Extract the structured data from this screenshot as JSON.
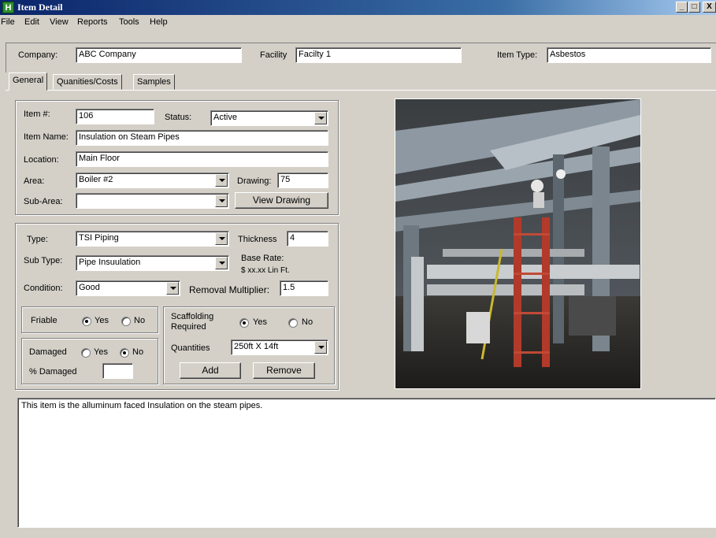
{
  "window": {
    "title": "Item Detail",
    "app_icon_letter": "H",
    "min": "_",
    "max": "□",
    "close": "X"
  },
  "menu": [
    "File",
    "Edit",
    "View",
    "Reports",
    "Tools",
    "Help"
  ],
  "header": {
    "company_label": "Company:",
    "company_value": "ABC Company",
    "facility_label": "Facility",
    "facility_value": "Facilty 1",
    "item_type_label": "Item Type:",
    "item_type_value": "Asbestos"
  },
  "tabs": [
    "General",
    "Quanities/Costs",
    "Samples"
  ],
  "general": {
    "item_no_label": "Item #:",
    "item_no": "106",
    "status_label": "Status:",
    "status": "Active",
    "item_name_label": "Item Name:",
    "item_name": "Insulation on Steam Pipes",
    "location_label": "Location:",
    "location": "Main Floor",
    "area_label": "Area:",
    "area": "Boiler #2",
    "drawing_label": "Drawing:",
    "drawing": "75",
    "subarea_label": "Sub-Area:",
    "subarea": "",
    "view_drawing": "View Drawing"
  },
  "material": {
    "type_label": "Type:",
    "type": "TSI Piping",
    "thickness_label": "Thickness",
    "thickness": "4",
    "subtype_label": "Sub Type:",
    "subtype": "Pipe Insuulation",
    "base_rate_label": "Base Rate:",
    "base_rate_value": "$ xx.xx Lin Ft.",
    "condition_label": "Condition:",
    "condition": "Good",
    "removal_label": "Removal Multiplier:",
    "removal": "1.5"
  },
  "friable": {
    "label": "Friable",
    "yes": "Yes",
    "no": "No",
    "selected": "Yes"
  },
  "damaged": {
    "label": "Damaged",
    "yes": "Yes",
    "no": "No",
    "selected": "No",
    "pct_label": "% Damaged",
    "pct_value": ""
  },
  "scaffolding": {
    "label_line1": "Scaffolding",
    "label_line2": "Required",
    "yes": "Yes",
    "no": "No",
    "selected": "Yes",
    "quantities_label": "Quantities",
    "quantities_value": "250ft X 14ft",
    "add": "Add",
    "remove": "Remove"
  },
  "notes": "This item is the alluminum faced Insulation on the steam pipes.",
  "photo": {
    "description_icon": "industrial-photo-icon"
  }
}
